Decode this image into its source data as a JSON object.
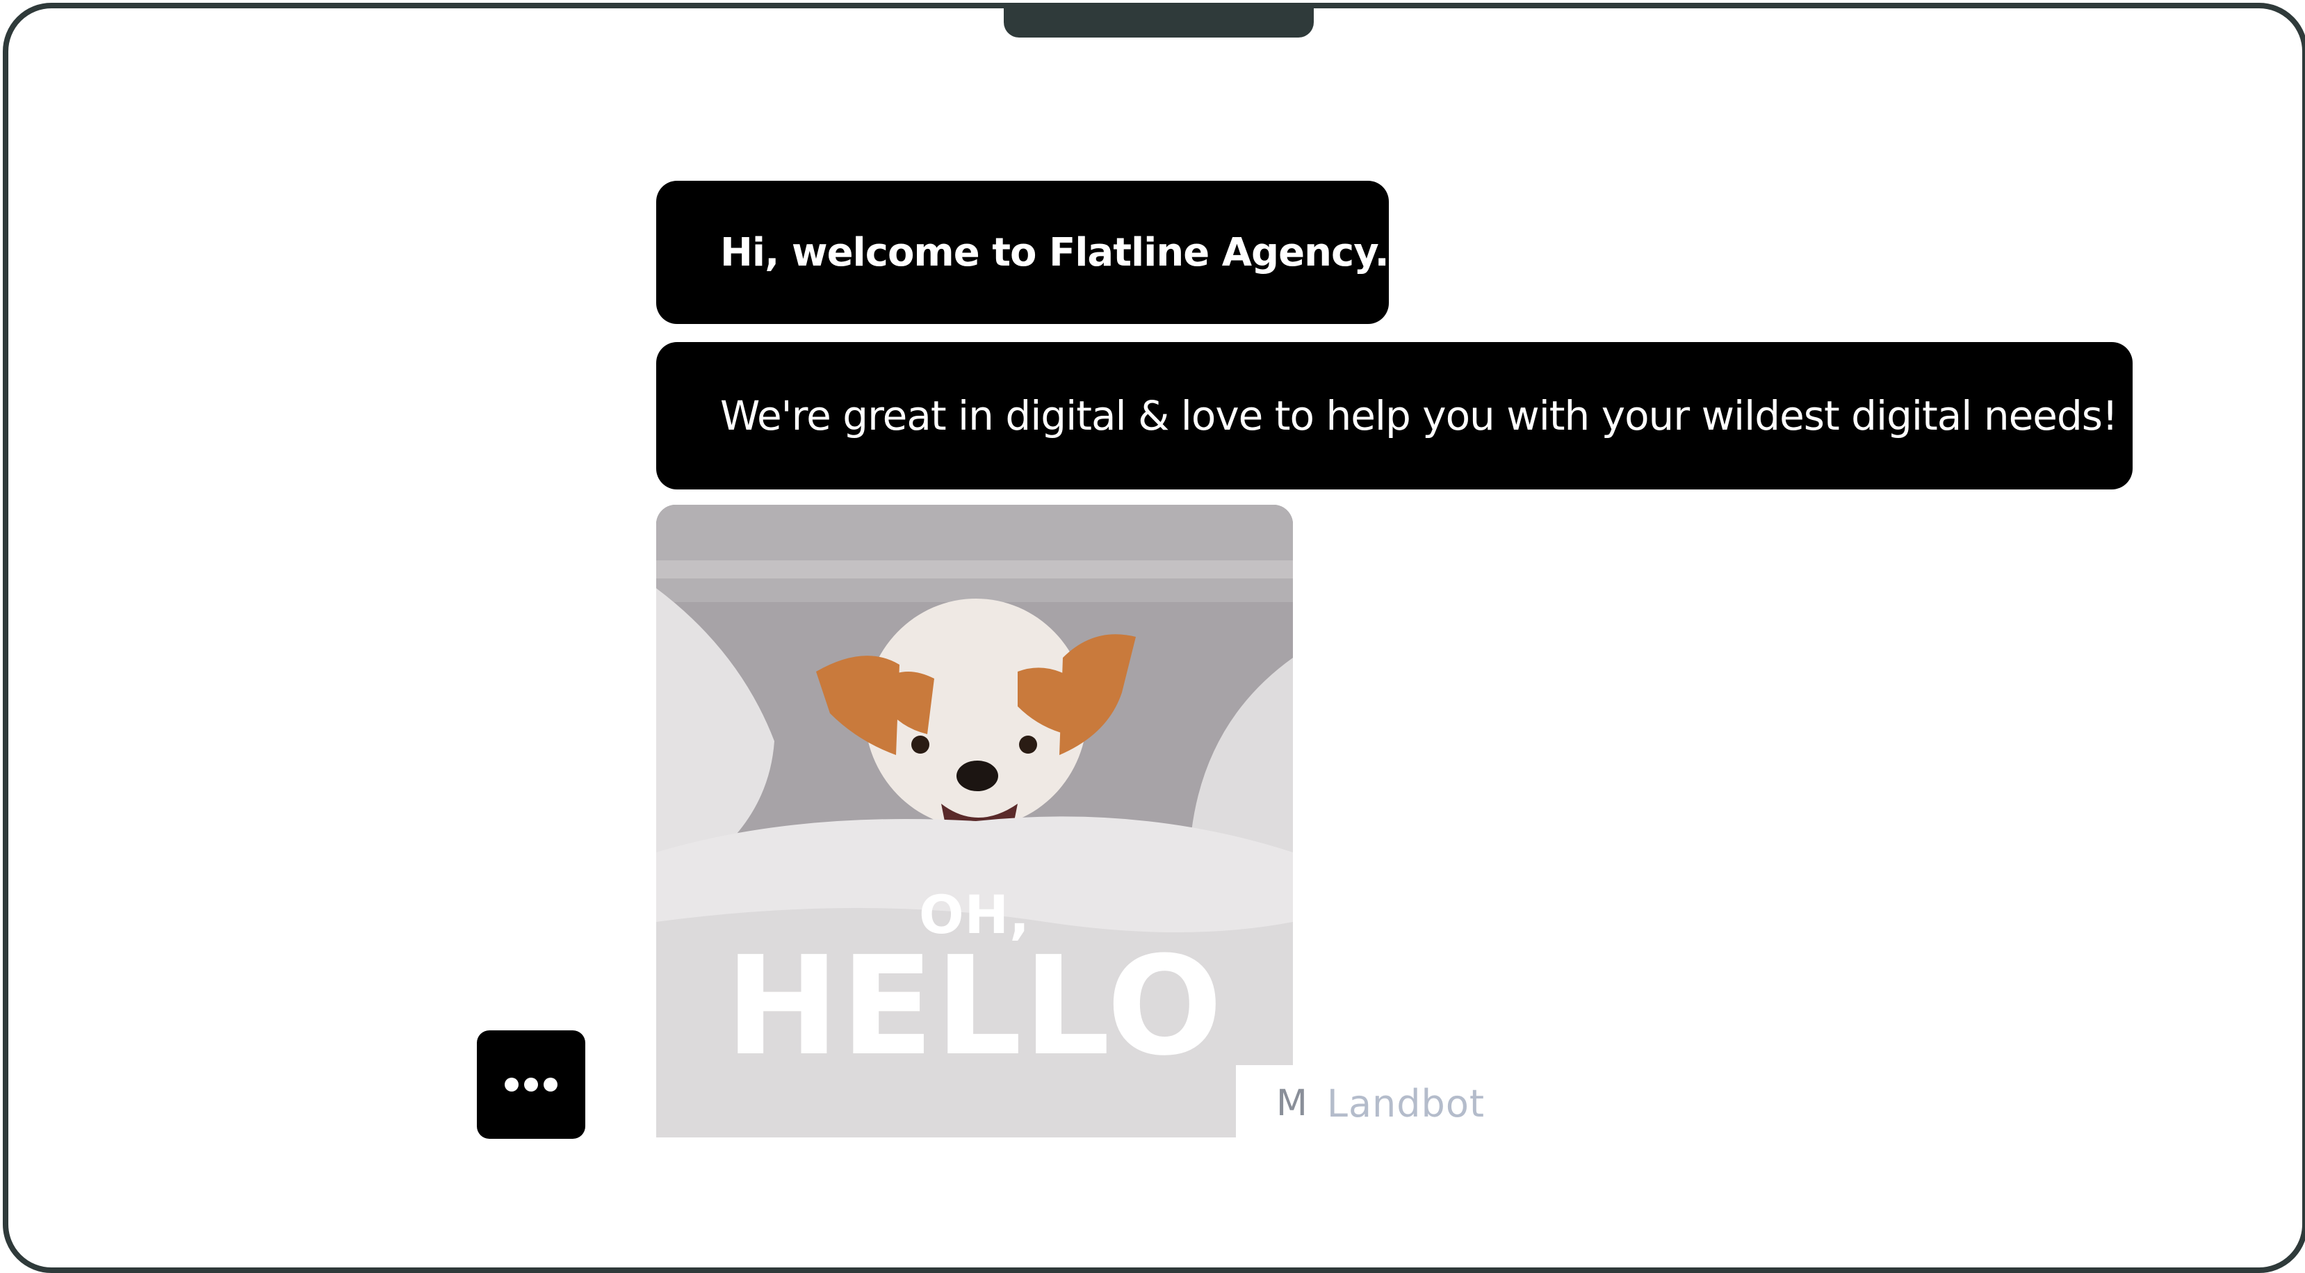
{
  "chat": {
    "messages": [
      {
        "text": "Hi, welcome to Flatline Agency."
      },
      {
        "text": "We're great in digital & love to help you with your wildest digital needs!"
      }
    ],
    "gif": {
      "line1": "OH,",
      "line2": "HELLO"
    }
  },
  "branding": {
    "prefix": "M",
    "brand": "Landbot"
  },
  "colors": {
    "bubble_bg": "#000000",
    "bubble_text": "#ffffff",
    "frame": "#2f3a3a"
  }
}
